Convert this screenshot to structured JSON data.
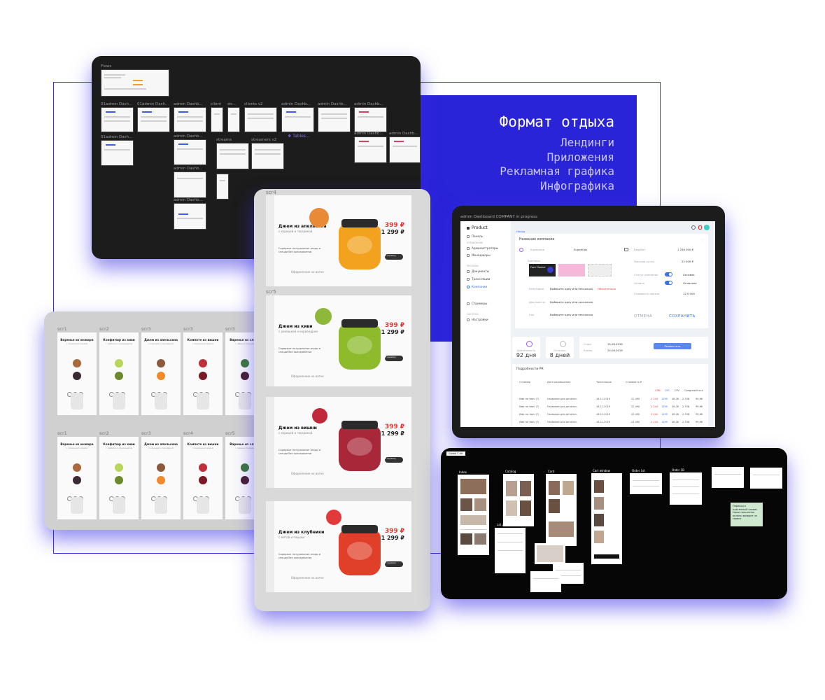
{
  "blue_panel": {
    "title": "Формат отдыха",
    "items": [
      "Лендинги",
      "Приложения",
      "Рекламная графика",
      "Инфографика"
    ]
  },
  "flows": {
    "section_label": "Flows",
    "frames": [
      "01admin Dash...",
      "01admin Dash...",
      "admin Dashb...",
      "client",
      "str...",
      "clients v2",
      "admin Dashb...",
      "admin Dashb...",
      "admin Dashb...",
      "01admin Dash...",
      "admin Dashb...",
      "streams",
      "streamers v2",
      "admin Dashb...",
      "admin Dashb...",
      "admin Dashb...",
      "admin Dashb..."
    ],
    "tables_link": "❖ Tables..."
  },
  "jams": {
    "screens": [
      {
        "tag": "scr4",
        "title": "Джем из апельсина",
        "sub": "с корицей и гвоздикой",
        "price_old": "399 ₽",
        "price_new": "1 299 ₽",
        "label": "Апельсин",
        "order_note": "Оформление на ватке"
      },
      {
        "tag": "scr5",
        "title": "Джем из киви",
        "sub": "с ромашкой и кориандром",
        "price_old": "399 ₽",
        "price_new": "1 299 ₽",
        "label": "Киви",
        "order_note": "Оформление на ватке"
      },
      {
        "tag": "",
        "title": "Джем из вишни",
        "sub": "с корицей и гвоздикой",
        "price_old": "399 ₽",
        "price_new": "1 299 ₽",
        "label": "Вишня",
        "order_note": "Оформление на ватке"
      },
      {
        "tag": "",
        "title": "Джем из клубники",
        "sub": "с мятой и перцем",
        "price_old": "399 ₽",
        "price_new": "1 299 ₽",
        "label": "Клубника",
        "order_note": "Оформление на ватке"
      }
    ],
    "cart_button": "В корзину"
  },
  "mobile": {
    "row1": [
      {
        "tag": "scr1",
        "title": "Варенье из инжира",
        "sub": "с лимонной коркой"
      },
      {
        "tag": "scr2",
        "title": "Конфитюр из киви",
        "sub": "с лаймом и кориандром"
      },
      {
        "tag": "scr3",
        "title": "Джем из апельсина",
        "sub": "с корицей и гвоздикой"
      },
      {
        "tag": "scr3",
        "title": "Компоте из вишни",
        "sub": "с лимонным мёдом"
      },
      {
        "tag": "scr3",
        "title": "Варенье из сливы",
        "sub": "с чёрным перцем"
      }
    ],
    "row2": [
      {
        "tag": "scr1",
        "title": "Варенье из инжира",
        "sub": "с лимонной коркой"
      },
      {
        "tag": "scr2",
        "title": "Конфитюр из киви",
        "sub": "с лаймом и кориандром"
      },
      {
        "tag": "scr3",
        "title": "Джем из апельсина",
        "sub": "с корицей и гвоздикой"
      },
      {
        "tag": "scr4",
        "title": "Компоте из вишни",
        "sub": "с лимонным мёдом"
      },
      {
        "tag": "scr5",
        "title": "Варенье из сливы",
        "sub": "с чёрным перцем"
      }
    ]
  },
  "dashboard": {
    "frame_label": "admin Dashboard COMPANY in progress",
    "brand": "Product",
    "sidebar": {
      "items": [
        "Панель",
        "Администраторы",
        "Менеджеры",
        "Документы",
        "Трансляции",
        "Компании",
        "Стримеры",
        "Настройки"
      ],
      "heads": [
        "УПРАВЛЕНИЕ",
        "РЕКЛАМА",
        "СИСТЕМА"
      ]
    },
    "breadcrumb": "Назад",
    "campaign_title": "Название компании",
    "fields": {
      "company": "Компания",
      "company_val": "SuperKids",
      "budget": "Бюджет",
      "budget_val": "1 256 000 ₽",
      "banners": "Баннеры",
      "banner_caption": "Face Flasher",
      "category": "Категория",
      "category_val": "Выберите одну или несколько",
      "documents": "Документы",
      "documents_val": "Выберите одну или несколько",
      "geo": "Гео",
      "geo_val": "Выберите одну или несколько",
      "active": "Статус компании",
      "active_val": "Активна",
      "paid": "Оплата",
      "paid_val": "Оплачена",
      "cpm": "Стоимость показа",
      "cpm_val": "12,5 000",
      "views": "Показов сутки",
      "views_val": "22 000 ₽",
      "new_tag": "Обязательно"
    },
    "cancel": "ОТМЕНА",
    "save": "СОХРАНИТЬ",
    "stats": [
      {
        "label": "Длительность",
        "value": "92 дня"
      },
      {
        "label": "Осталось",
        "value": "8 дней"
      }
    ],
    "dates": {
      "start": "Старт",
      "start_val": "15.06.2019",
      "end": "Конец",
      "end_val": "24.06.2019"
    },
    "action_btn": "Разместить",
    "details_title": "Подробности РК",
    "table_headers": [
      "Стример",
      "Дата размещения",
      "Трансляция",
      "Стоимость ₽",
      "CPM",
      "CPC",
      "CPV",
      "Среднее",
      "Анализ",
      "Итого"
    ],
    "rows": [
      [
        "Имя на твич (?)",
        "Название для детализ.",
        "16.11.2019",
        "22 490",
        "2 244",
        "1299",
        "48,26",
        "2,338",
        "99,66"
      ],
      [
        "Имя на твич (?)",
        "Название для детализ.",
        "16.11.2019",
        "22 490",
        "2 244",
        "1299",
        "48,26",
        "2,338",
        "99,66"
      ],
      [
        "Имя на твич (?)",
        "Название для детализ.",
        "16.11.2019",
        "22 490",
        "2 244",
        "1299",
        "48,26",
        "2,338",
        "99,66"
      ],
      [
        "Имя на твич (?)",
        "Название для детализ.",
        "16.11.2019",
        "22 490",
        "2 244",
        "1299",
        "48,26",
        "2,338",
        "99,66"
      ]
    ]
  },
  "ux": {
    "global_label": "Global C-bit",
    "frames": [
      "Index",
      "Catalog",
      "Card",
      "Cart window",
      "Order 1st",
      "Order 1B"
    ],
    "cat_grid": "cat grid 2",
    "note": "Переход в платежный сервис. Ниже пояснения оплаты возврат на сервис."
  }
}
